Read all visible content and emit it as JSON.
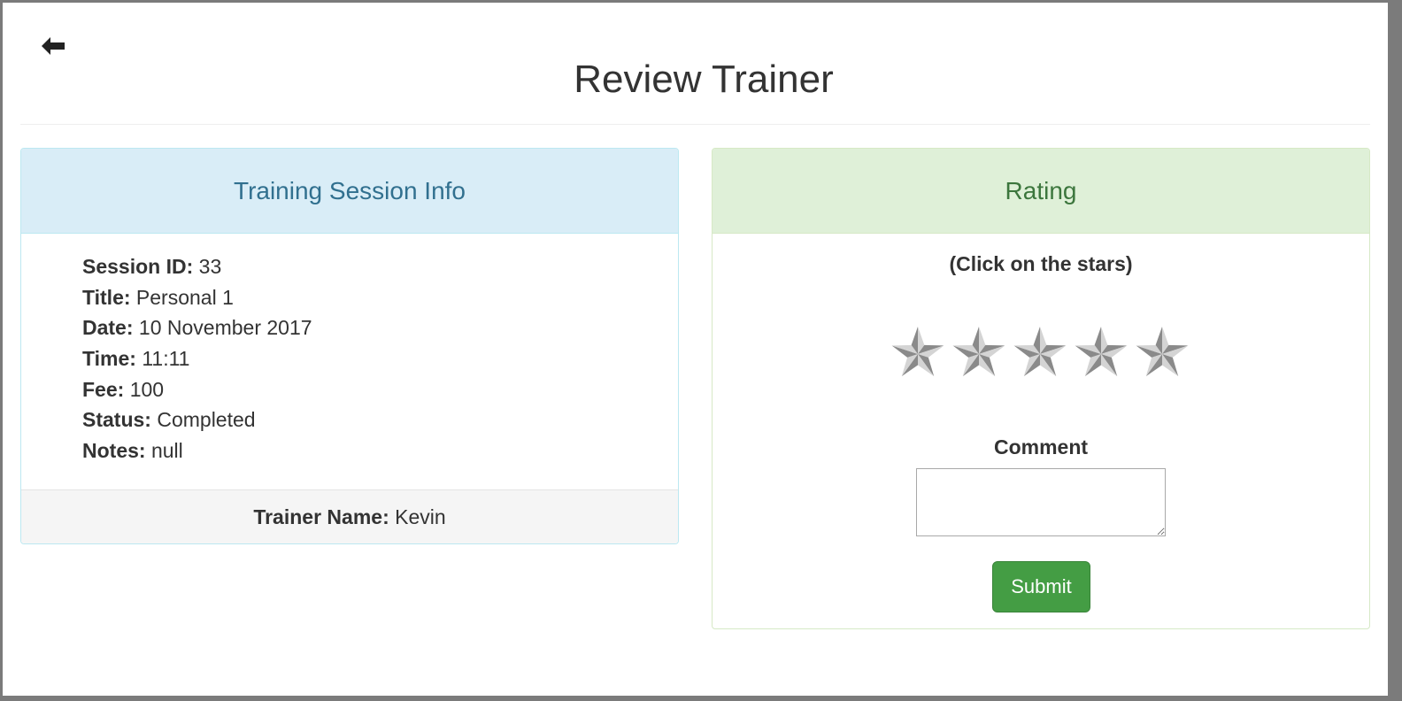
{
  "page": {
    "title": "Review Trainer"
  },
  "session_panel": {
    "heading": "Training Session Info",
    "fields": [
      {
        "label": "Session ID:",
        "value": "33"
      },
      {
        "label": "Title:",
        "value": "Personal 1"
      },
      {
        "label": "Date:",
        "value": "10 November 2017"
      },
      {
        "label": "Time:",
        "value": "11:11"
      },
      {
        "label": "Fee:",
        "value": "100"
      },
      {
        "label": "Status:",
        "value": "Completed"
      },
      {
        "label": "Notes:",
        "value": "null"
      }
    ],
    "footer": {
      "label": "Trainer Name:",
      "value": "Kevin"
    }
  },
  "rating_panel": {
    "heading": "Rating",
    "hint": "(Click on the stars)",
    "stars_total": 5,
    "stars_selected": 0,
    "comment_label": "Comment",
    "comment_value": "",
    "submit_label": "Submit"
  },
  "colors": {
    "info_heading_bg": "#d9edf7",
    "info_heading_text": "#31708f",
    "rating_heading_bg": "#dff0d8",
    "rating_heading_text": "#3c763d",
    "submit_bg": "#449d44"
  },
  "icons": {
    "back": "arrow-left-icon",
    "star": "star-icon"
  }
}
